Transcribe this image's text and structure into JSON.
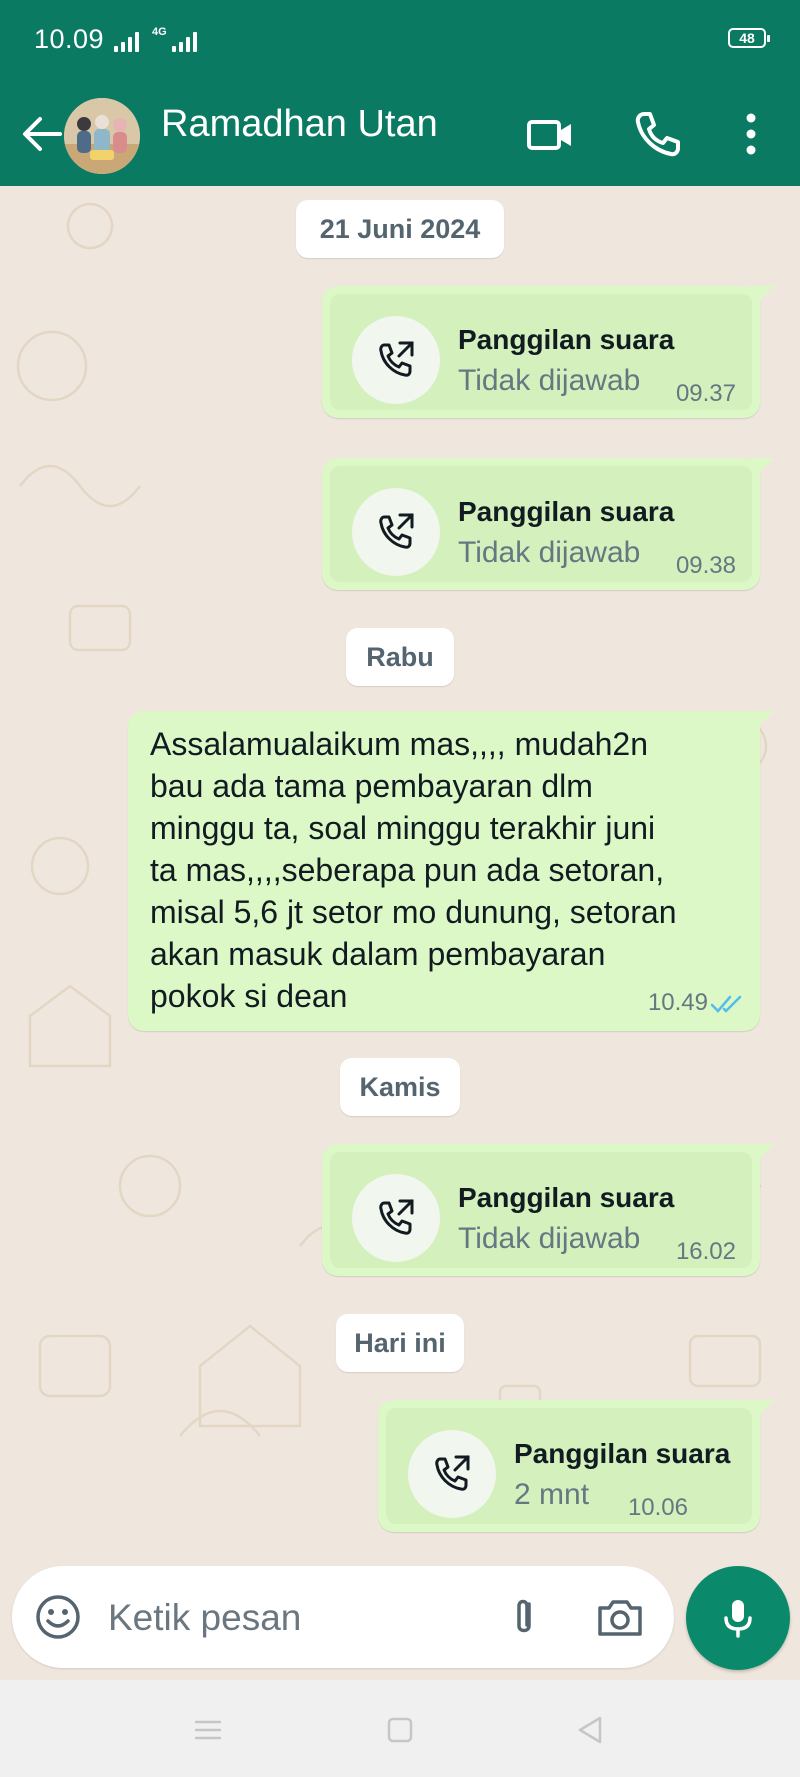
{
  "status_bar": {
    "time": "10.09",
    "network": "4G",
    "battery": "48"
  },
  "header": {
    "contact_name": "Ramadhan Utan"
  },
  "messages": [
    {
      "type": "date",
      "label": "21 Juni 2024"
    },
    {
      "type": "call",
      "title": "Panggilan suara",
      "subtitle": "Tidak dijawab",
      "time": "09.37"
    },
    {
      "type": "call",
      "title": "Panggilan suara",
      "subtitle": "Tidak dijawab",
      "time": "09.38"
    },
    {
      "type": "date",
      "label": "Rabu"
    },
    {
      "type": "text",
      "text": "Assalamualaikum mas,,,, mudah2n\nbau ada tama pembayaran dlm\nminggu ta, soal minggu terakhir juni\nta mas,,,,seberapa pun ada setoran,\nmisal 5,6 jt setor mo dunung, setoran\nakan masuk dalam pembayaran\npokok si dean",
      "time": "10.49",
      "status": "read"
    },
    {
      "type": "date",
      "label": "Kamis"
    },
    {
      "type": "call",
      "title": "Panggilan suara",
      "subtitle": "Tidak dijawab",
      "time": "16.02"
    },
    {
      "type": "date",
      "label": "Hari ini"
    },
    {
      "type": "call",
      "title": "Panggilan suara",
      "subtitle": "2 mnt",
      "time": "10.06"
    }
  ],
  "composer": {
    "placeholder": "Ketik pesan"
  },
  "colors": {
    "header": "#0b7a62",
    "outgoing_bubble": "#dcf8c6",
    "chat_background": "#efe7dd",
    "mic_button": "#0b8a6b",
    "read_ticks": "#53bdeb"
  },
  "icons": [
    "back-arrow-icon",
    "video-call-icon",
    "voice-call-icon",
    "more-options-icon",
    "outgoing-call-icon",
    "emoji-icon",
    "attach-icon",
    "camera-icon",
    "mic-icon",
    "read-ticks-icon"
  ]
}
